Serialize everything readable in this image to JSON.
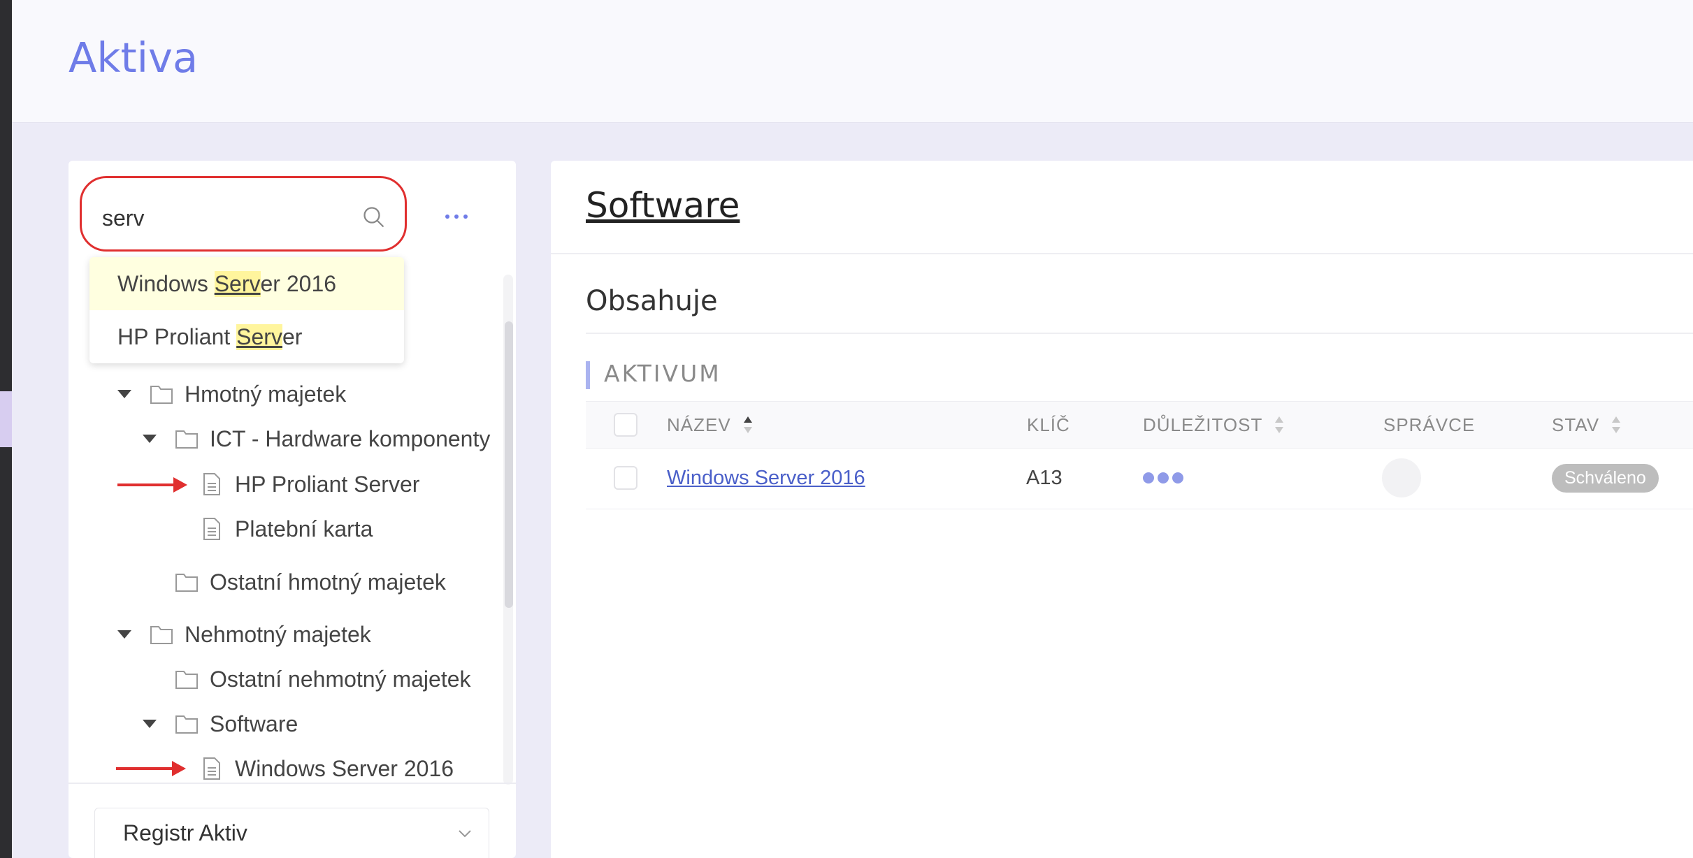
{
  "header": {
    "title": "Aktiva"
  },
  "search": {
    "value": "serv"
  },
  "suggestions": [
    {
      "before": "Windows ",
      "match": "Serv",
      "after": "er 2016"
    },
    {
      "before": "HP Proliant ",
      "match": "Serv",
      "after": "er"
    }
  ],
  "tree": [
    {
      "label": "Hmotný majetek"
    },
    {
      "label": "ICT - Hardware komponenty"
    },
    {
      "label": "HP Proliant Server"
    },
    {
      "label": "Platební karta"
    },
    {
      "label": "Ostatní hmotný majetek"
    },
    {
      "label": "Nehmotný majetek"
    },
    {
      "label": "Ostatní nehmotný majetek"
    },
    {
      "label": "Software"
    },
    {
      "label": "Windows Server 2016"
    }
  ],
  "registry_select": {
    "value": "Registr Aktiv"
  },
  "detail": {
    "title": "Software",
    "contains_title": "Obsahuje",
    "group_label": "AKTIVUM",
    "columns": {
      "name": "NÁZEV",
      "key": "KLÍČ",
      "importance": "DŮLEŽITOST",
      "owner": "SPRÁVCE",
      "status": "STAV"
    },
    "rows": [
      {
        "name": "Windows Server 2016",
        "key": "A13",
        "importance_level": 3,
        "status": "Schváleno"
      }
    ]
  },
  "colors": {
    "accent": "#6f7ce8",
    "highlight": "#fff59d",
    "annotation_red": "#e02f2f",
    "status_gray": "#bdbdbd"
  }
}
